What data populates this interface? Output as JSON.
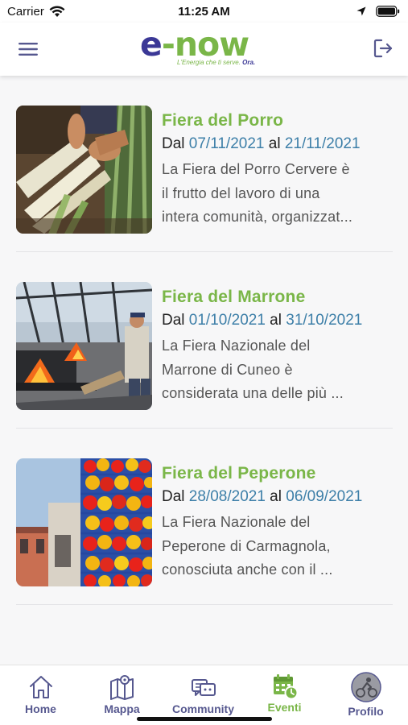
{
  "status_bar": {
    "carrier": "Carrier",
    "time": "11:25 AM"
  },
  "header": {
    "logo": {
      "e": "e",
      "dash": "-",
      "now": "now",
      "tagline_pre": "L'Energia che ti serve.",
      "tagline_bold": "Ora."
    }
  },
  "events": [
    {
      "title": "Fiera del Porro",
      "dal": "Dal",
      "al": "al",
      "start": "07/11/2021",
      "end": "21/11/2021",
      "desc_lines": [
        "La Fiera del Porro Cervere è",
        "il frutto del lavoro di una",
        "intera comunità, organizzat..."
      ],
      "image": "leeks-harvest-photo"
    },
    {
      "title": "Fiera del Marrone",
      "dal": "Dal",
      "al": "al",
      "start": "01/10/2021",
      "end": "31/10/2021",
      "desc_lines": [
        "La Fiera Nazionale del",
        "Marrone di Cuneo è",
        "considerata una delle più ..."
      ],
      "image": "chestnut-roasting-photo"
    },
    {
      "title": "Fiera del Peperone",
      "dal": "Dal",
      "al": "al",
      "start": "28/08/2021",
      "end": "06/09/2021",
      "desc_lines": [
        "La Fiera Nazionale del",
        "Peperone di Carmagnola,",
        "conosciuta anche con il ..."
      ],
      "image": "peppers-crates-photo"
    }
  ],
  "tabs": [
    {
      "label": "Home",
      "icon": "home-icon"
    },
    {
      "label": "Mappa",
      "icon": "map-icon"
    },
    {
      "label": "Community",
      "icon": "community-icon"
    },
    {
      "label": "Eventi",
      "icon": "calendar-clock-icon",
      "active": true
    },
    {
      "label": "Profilo",
      "icon": "avatar-icon"
    }
  ],
  "colors": {
    "brand_green": "#7ab648",
    "brand_navy": "#3b3896",
    "date_blue": "#3d7fa8",
    "tab_inactive": "#56588f"
  }
}
